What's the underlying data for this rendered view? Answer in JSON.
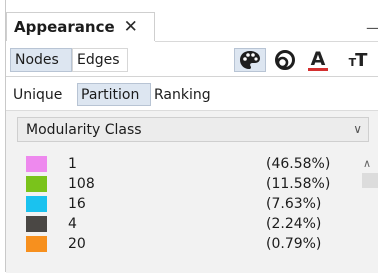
{
  "panel": {
    "title": "Appearance",
    "close_glyph": "✕",
    "minimize_glyph": "—"
  },
  "toolbar": {
    "nodes_label": "Nodes",
    "edges_label": "Edges",
    "color_tool_icon": "palette-icon",
    "size_tool_icon": "size-rings-icon",
    "label_color_letter": "A",
    "label_size_letters_small": "T",
    "label_size_letters_big": "T",
    "accent_color": "#d32f2f"
  },
  "subtabs": {
    "unique": "Unique",
    "partition": "Partition",
    "ranking": "Ranking"
  },
  "attribute": {
    "selected": "Modularity Class",
    "arrow_glyph": "∨"
  },
  "partition_items": [
    {
      "label": "1",
      "percent": "(46.58%)",
      "color": "#ee89ee"
    },
    {
      "label": "108",
      "percent": "(11.58%)",
      "color": "#7ac31b"
    },
    {
      "label": "16",
      "percent": "(7.63%)",
      "color": "#1ac2ef"
    },
    {
      "label": "4",
      "percent": "(2.24%)",
      "color": "#4a4744"
    },
    {
      "label": "20",
      "percent": "(0.79%)",
      "color": "#f7901e"
    }
  ],
  "scrollbar": {
    "up_glyph": "∧"
  }
}
